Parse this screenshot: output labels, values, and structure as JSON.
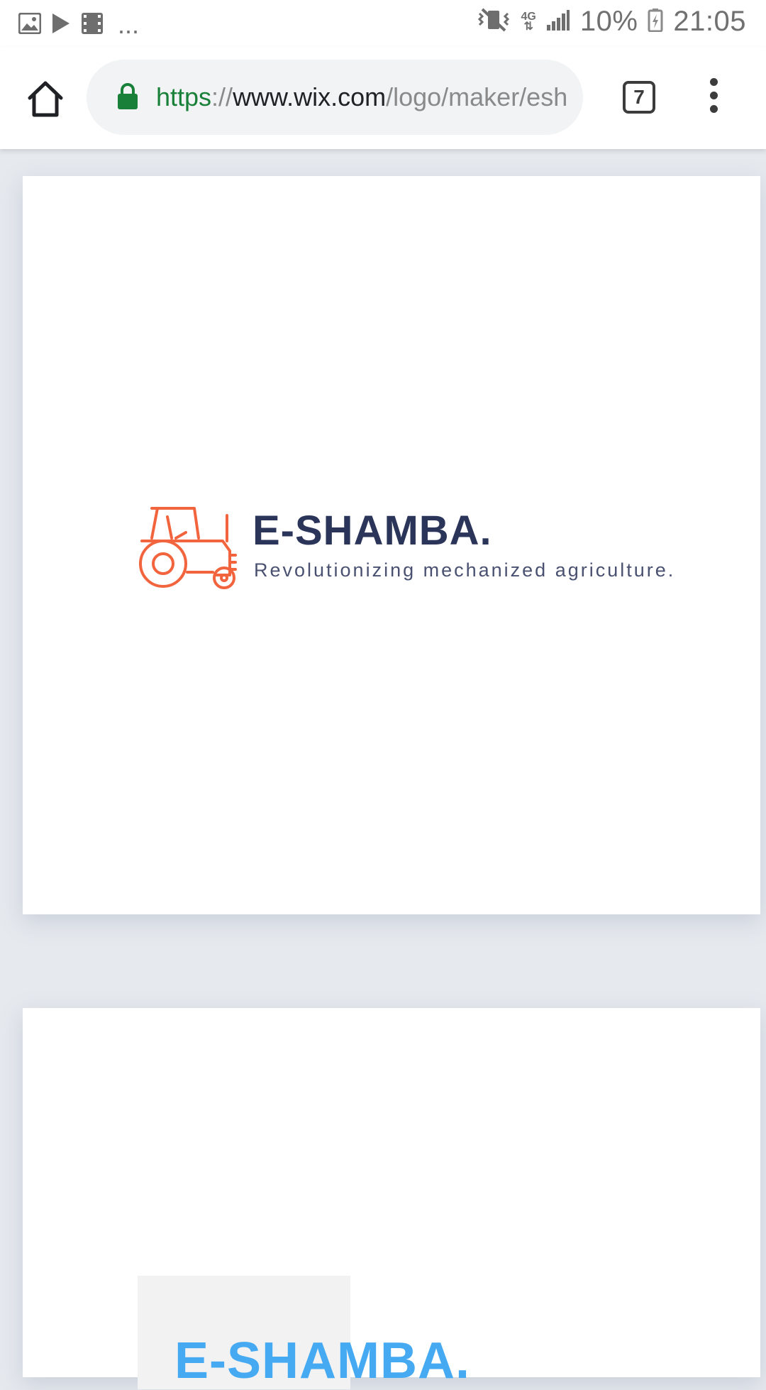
{
  "status_bar": {
    "overflow_indicator": "...",
    "network_type": "4G",
    "battery_percent": "10%",
    "time": "21:05",
    "icons": [
      "image-icon",
      "play-icon",
      "video-icon",
      "vibrate-icon",
      "signal-icon",
      "battery-icon"
    ]
  },
  "browser": {
    "url": {
      "scheme": "https",
      "separator": "://",
      "host": "www.wix.com",
      "path": "/logo/maker/esh"
    },
    "tab_count": "7"
  },
  "logos": [
    {
      "name": "E-SHAMBA.",
      "tagline": "Revolutionizing mechanized agriculture.",
      "icon": "tractor-icon",
      "icon_color": "#f2643d",
      "text_color": "#2b3559"
    },
    {
      "name": "E-SHAMBA.",
      "text_color": "#45aaf2"
    }
  ],
  "colors": {
    "page_background": "#e6e9ee",
    "secure_green": "#188038"
  }
}
